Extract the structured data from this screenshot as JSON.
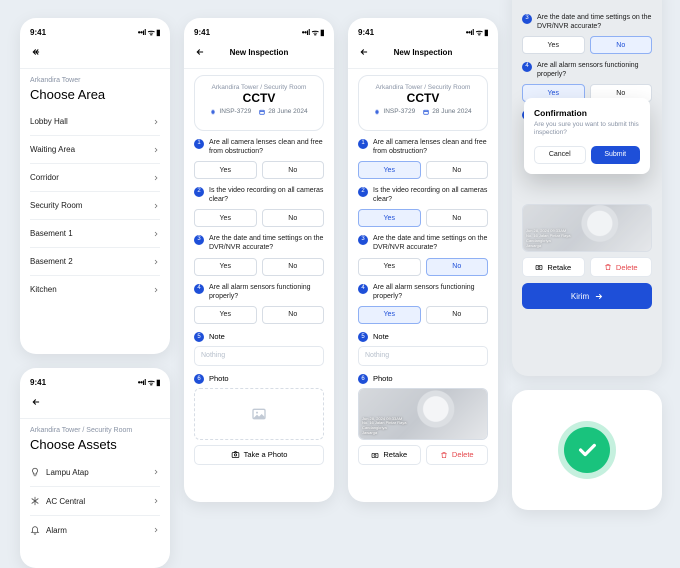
{
  "status_time": "9:41",
  "colors": {
    "primary": "#1e4fd8",
    "danger": "#e5484d",
    "success": "#19c37d"
  },
  "screen1": {
    "breadcrumb": "Arkandira Tower",
    "title": "Choose Area",
    "items": [
      {
        "label": "Lobby Hall"
      },
      {
        "label": "Waiting Area"
      },
      {
        "label": "Corridor"
      },
      {
        "label": "Security Room"
      },
      {
        "label": "Basement 1"
      },
      {
        "label": "Basement 2"
      },
      {
        "label": "Kitchen"
      }
    ]
  },
  "screen2": {
    "breadcrumb": "Arkandira Tower / Security Room",
    "title": "Choose Assets",
    "items": [
      {
        "label": "Lampu Atap",
        "icon": "lightbulb"
      },
      {
        "label": "AC Central",
        "icon": "snowflake"
      },
      {
        "label": "Alarm",
        "icon": "bell"
      }
    ]
  },
  "inspection": {
    "header": "New Inspection",
    "breadcrumb": "Arkandira Tower / Security Room",
    "asset": "CCTV",
    "id_prefix": "#",
    "id": "INSP-3729",
    "date": "28 June 2024",
    "questions": [
      {
        "n": "1",
        "text": "Are all camera lenses clean and free from obstruction?"
      },
      {
        "n": "2",
        "text": "Is the video recording on all cameras clear?"
      },
      {
        "n": "3",
        "text": "Are the date and time settings on the DVR/NVR accurate?"
      },
      {
        "n": "4",
        "text": "Are all alarm sensors functioning properly?"
      }
    ],
    "yes": "Yes",
    "no": "No",
    "note_label": "Note",
    "note_num": "5",
    "note_placeholder": "Nothing",
    "photo_label": "Photo",
    "photo_num": "6",
    "take_photo": "Take a Photo",
    "retake": "Retake",
    "delete": "Delete",
    "submit": "Kirim",
    "photo_watermark": "Jun 28, 2024 09:33AM\nNo. 16 Jalan Pintar Raya\nCandangkriya\nJawarga"
  },
  "answers_screen4": {
    "q1": "Yes",
    "q2": "Yes",
    "q3": "No",
    "q4": "Yes"
  },
  "confirm": {
    "title": "Confirmation",
    "body": "Are you sure you want to submit this inspection?",
    "cancel": "Cancel",
    "submit": "Submit"
  }
}
